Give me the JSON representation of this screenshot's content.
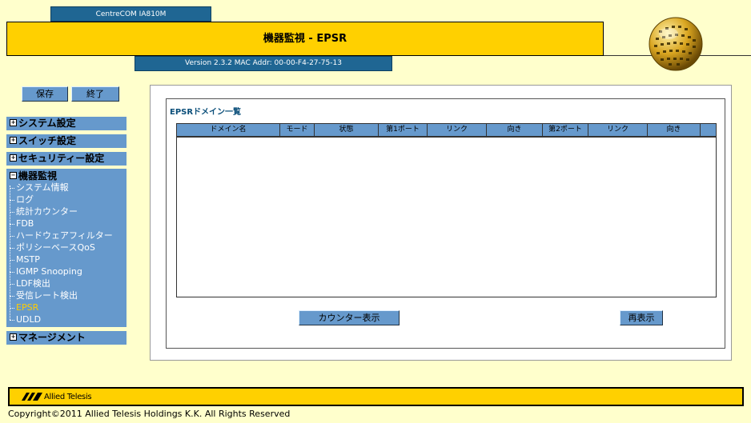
{
  "header": {
    "device_name": "CentreCOM IA810M",
    "title": "機器監視 - EPSR",
    "version": "Version 2.3.2 MAC Addr: 00-00-F4-27-75-13"
  },
  "buttons": {
    "save": "保存",
    "exit": "終了"
  },
  "nav": {
    "system": "システム設定",
    "switch": "スイッチ設定",
    "security": "セキュリティー設定",
    "monitor": "機器監視",
    "monitor_items": [
      "システム情報",
      "ログ",
      "統計カウンター",
      "FDB",
      "ハードウェアフィルター",
      "ポリシーベースQoS",
      "MSTP",
      "IGMP Snooping",
      "LDF検出",
      "受信レート検出",
      "EPSR",
      "UDLD"
    ],
    "management": "マネージメント",
    "expand_symbol": "+",
    "collapse_symbol": "−"
  },
  "main": {
    "section_title": "EPSRドメイン一覧",
    "columns": [
      "ドメイン名",
      "モード",
      "状態",
      "第1ポート",
      "リンク",
      "向き",
      "第2ポート",
      "リンク",
      "向き"
    ],
    "rows": [],
    "counter_button": "カウンター表示",
    "refresh_button": "再表示"
  },
  "footer": {
    "brand": "Allied Telesis",
    "copyright": "Copyright©2011 Allied Telesis Holdings K.K. All Rights Reserved"
  },
  "colors": {
    "background": "#FFFFCC",
    "header_yellow": "#FFD000",
    "nav_blue": "#6699CC",
    "dark_blue": "#1F6693",
    "active_item": "#FFCC00"
  }
}
